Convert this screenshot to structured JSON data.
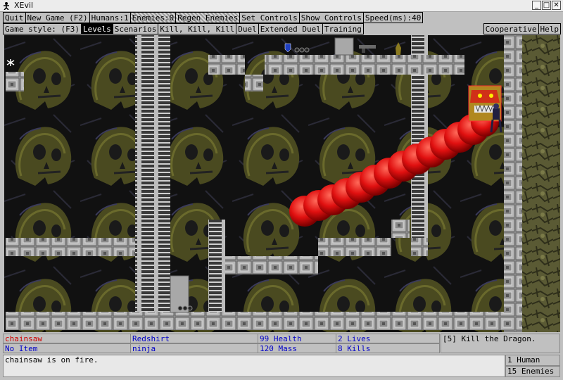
{
  "window": {
    "title": "XEvil"
  },
  "menu": {
    "quit": "Quit",
    "new_game": "New Game (F2)",
    "humans": "Humans:1",
    "enemies": "Enemies:0",
    "regen_enemies": "Regen Enemies",
    "set_controls": "Set Controls",
    "show_controls": "Show Controls",
    "speed": "Speed(ms):40"
  },
  "style_bar": {
    "label": "Game style: (F3)",
    "modes": [
      "Levels",
      "Scenarios",
      "Kill, Kill, Kill",
      "Duel",
      "Extended Duel",
      "Training"
    ],
    "selected": "Levels",
    "cooperative": "Cooperative",
    "help": "Help"
  },
  "status": {
    "weapon": "chainsaw",
    "item": "No Item",
    "player_name": "Redshirt",
    "player_class": "ninja",
    "health": "99 Health",
    "mass": "120 Mass",
    "lives": "2 Lives",
    "kills": "8 Kills",
    "objective": "[5] Kill the Dragon.",
    "message": "chainsaw is on fire.",
    "humans_count": "1 Human",
    "enemies_count": "15 Enemies",
    "colors": {
      "weapon": "#d00000",
      "info": "#0000c8"
    }
  }
}
